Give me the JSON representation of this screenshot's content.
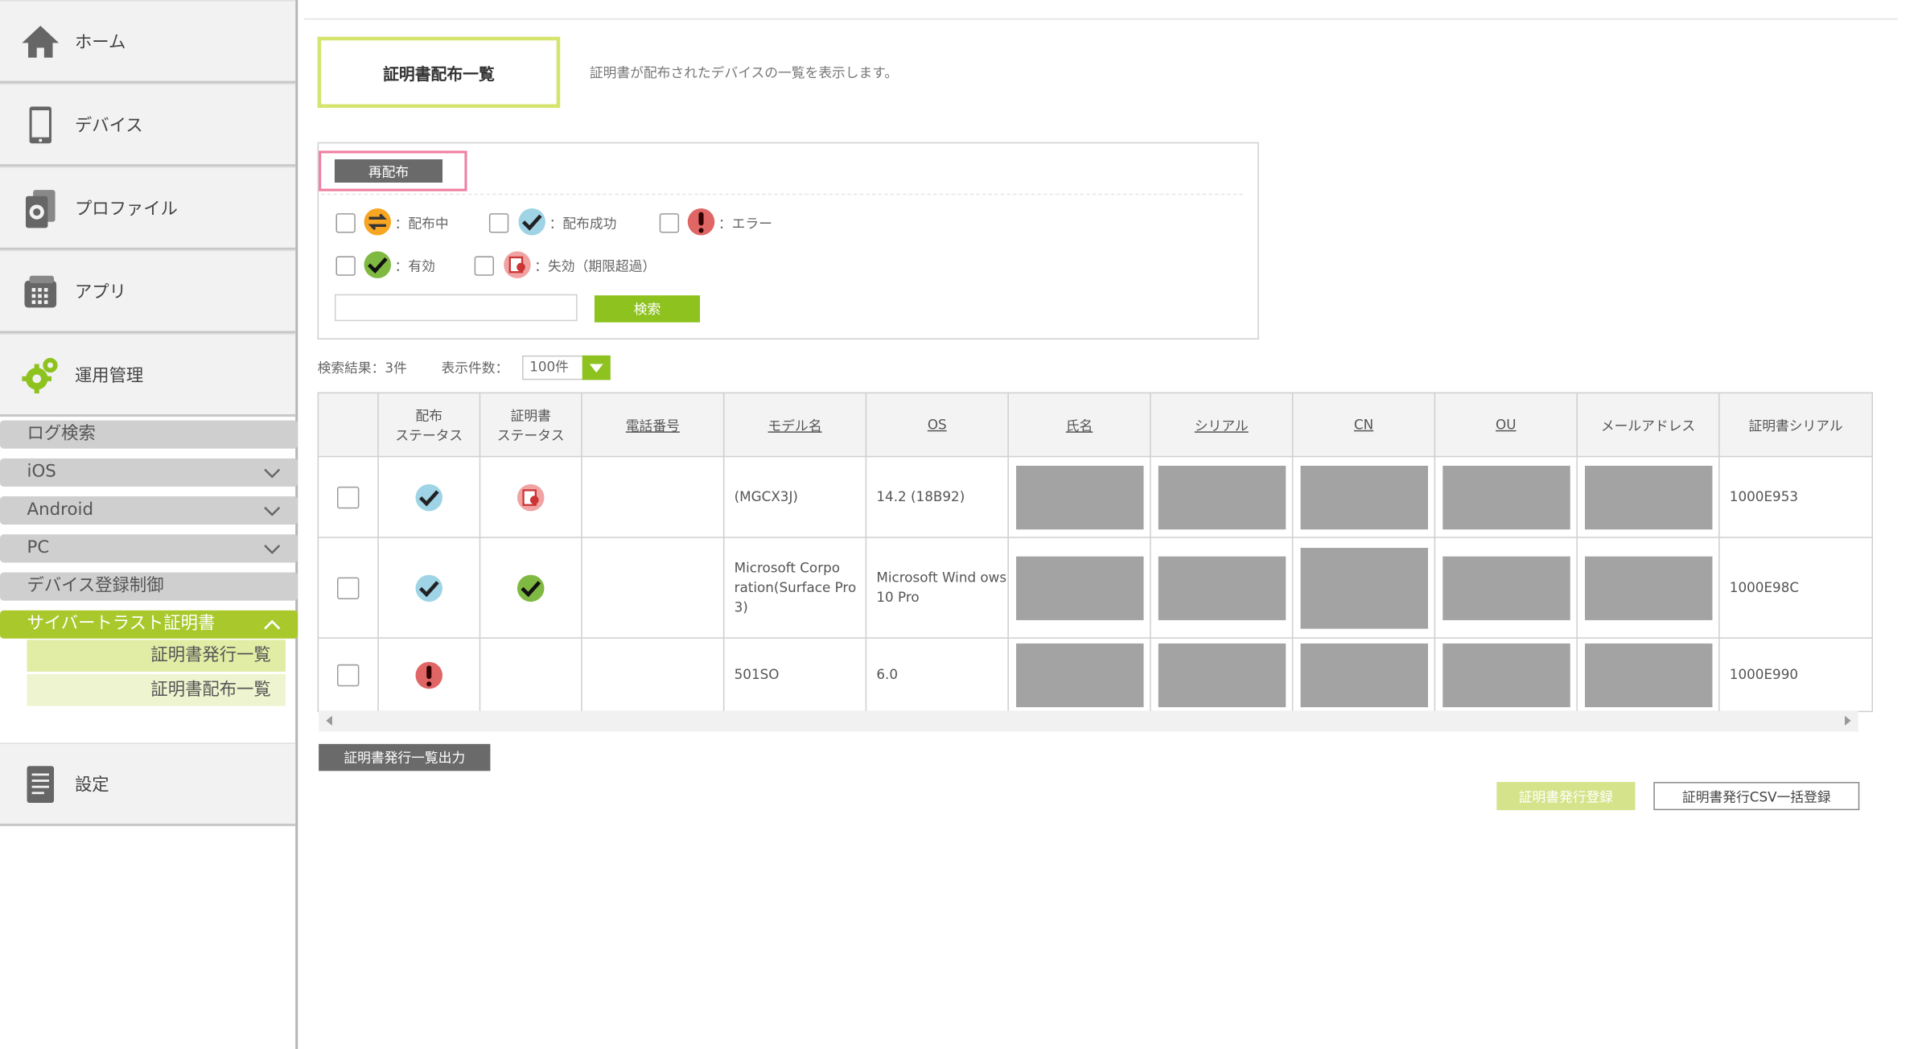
{
  "sidebar": {
    "home": "ホーム",
    "devices": "デバイス",
    "profiles": "プロファイル",
    "apps": "アプリ",
    "operations": "運用管理",
    "settings": "設定",
    "sub_items": [
      "ログ検索",
      "iOS",
      "Android",
      "PC",
      "デバイス登録制御",
      "サイバートラスト証明書"
    ],
    "cert_items": [
      "証明書発行一覧",
      "証明書配布一覧"
    ]
  },
  "page": {
    "title": "証明書配布一覧",
    "description": "証明書が配布されたデバイスの一覧を表示します。"
  },
  "filter": {
    "redeploy_label": "再配布",
    "legend": {
      "distributing": "：配布中",
      "success": "：配布成功",
      "error": "：エラー",
      "valid": "：有効",
      "expired": "：失効（期限超過）"
    },
    "search_value": "",
    "search_label": "検索"
  },
  "results": {
    "count_label": "検索結果：3件",
    "per_page_label": "表示件数：",
    "per_page_value": "100件"
  },
  "table": {
    "headers": {
      "dist_status": "配布\nステータス",
      "cert_status": "証明書\nステータス",
      "phone": "電話番号",
      "model": "モデル名",
      "os": "OS",
      "name": "氏名",
      "serial": "シリアル",
      "cn": "CN",
      "ou": "OU",
      "email": "メールアドレス",
      "cert_serial": "証明書シリアル"
    },
    "rows": [
      {
        "dist_status": "success-check",
        "cert_status": "expired",
        "phone": "",
        "model": "(MGCX3J)",
        "os": "14.2 (18B92)",
        "cert_serial": "1000E953"
      },
      {
        "dist_status": "success-check",
        "cert_status": "valid-check",
        "phone": "",
        "model": "Microsoft Corpo ration(Surface Pro 3)",
        "os": "Microsoft Wind ows 10 Pro",
        "cert_serial": "1000E98C"
      },
      {
        "dist_status": "error",
        "cert_status": "",
        "phone": "",
        "model": "501SO",
        "os": "6.0",
        "cert_serial": "1000E990"
      }
    ]
  },
  "actions": {
    "export_label": "証明書発行一覧出力",
    "register_label": "証明書発行登録",
    "csv_label": "証明書発行CSV一括登録"
  },
  "colors": {
    "accent_green": "#8dc21f",
    "active_nav": "#a9c82c",
    "pale_green": "#d5e48a"
  }
}
